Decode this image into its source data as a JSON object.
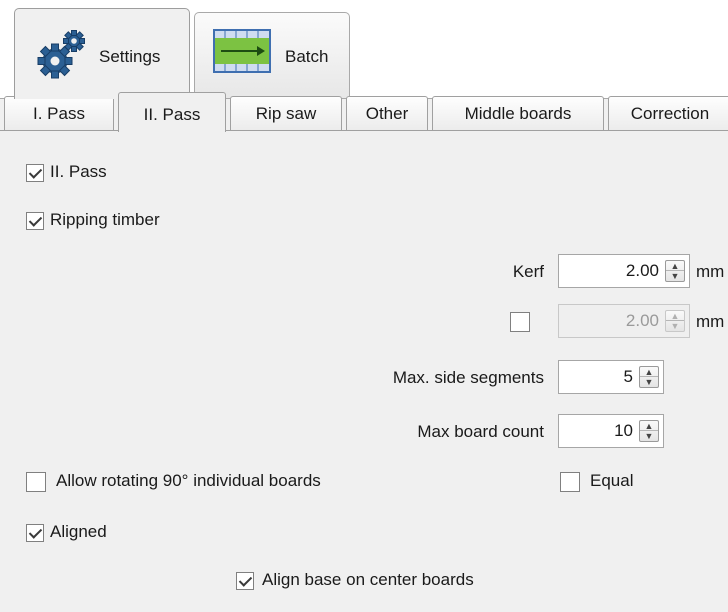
{
  "top_tabs": [
    {
      "label": "Settings",
      "icon": "gear-icon",
      "active": true
    },
    {
      "label": "Batch",
      "icon": "batch-icon",
      "active": false
    }
  ],
  "sub_tabs": [
    {
      "label": "I. Pass"
    },
    {
      "label": "II. Pass",
      "active": true
    },
    {
      "label": "Rip saw"
    },
    {
      "label": "Other"
    },
    {
      "label": "Middle boards"
    },
    {
      "label": "Correction"
    }
  ],
  "form": {
    "second_pass": {
      "label": "II. Pass",
      "checked": true
    },
    "ripping_timber": {
      "label": "Ripping timber",
      "checked": true
    },
    "kerf": {
      "label": "Kerf",
      "value": "2.00",
      "unit": "mm"
    },
    "kerf2": {
      "checked": false,
      "value": "2.00",
      "unit": "mm",
      "disabled": true
    },
    "max_side_segments": {
      "label": "Max. side segments",
      "value": "5"
    },
    "max_board_count": {
      "label": "Max board count",
      "value": "10"
    },
    "allow_rotating": {
      "label": "Allow rotating 90° individual boards",
      "checked": false
    },
    "equal": {
      "label": "Equal",
      "checked": false
    },
    "aligned": {
      "label": "Aligned",
      "checked": true
    },
    "align_base": {
      "label": "Align base on center boards",
      "checked": true
    }
  },
  "colors": {
    "panel": "#f0f0f0",
    "batch_icon_green": "#7cc242"
  }
}
